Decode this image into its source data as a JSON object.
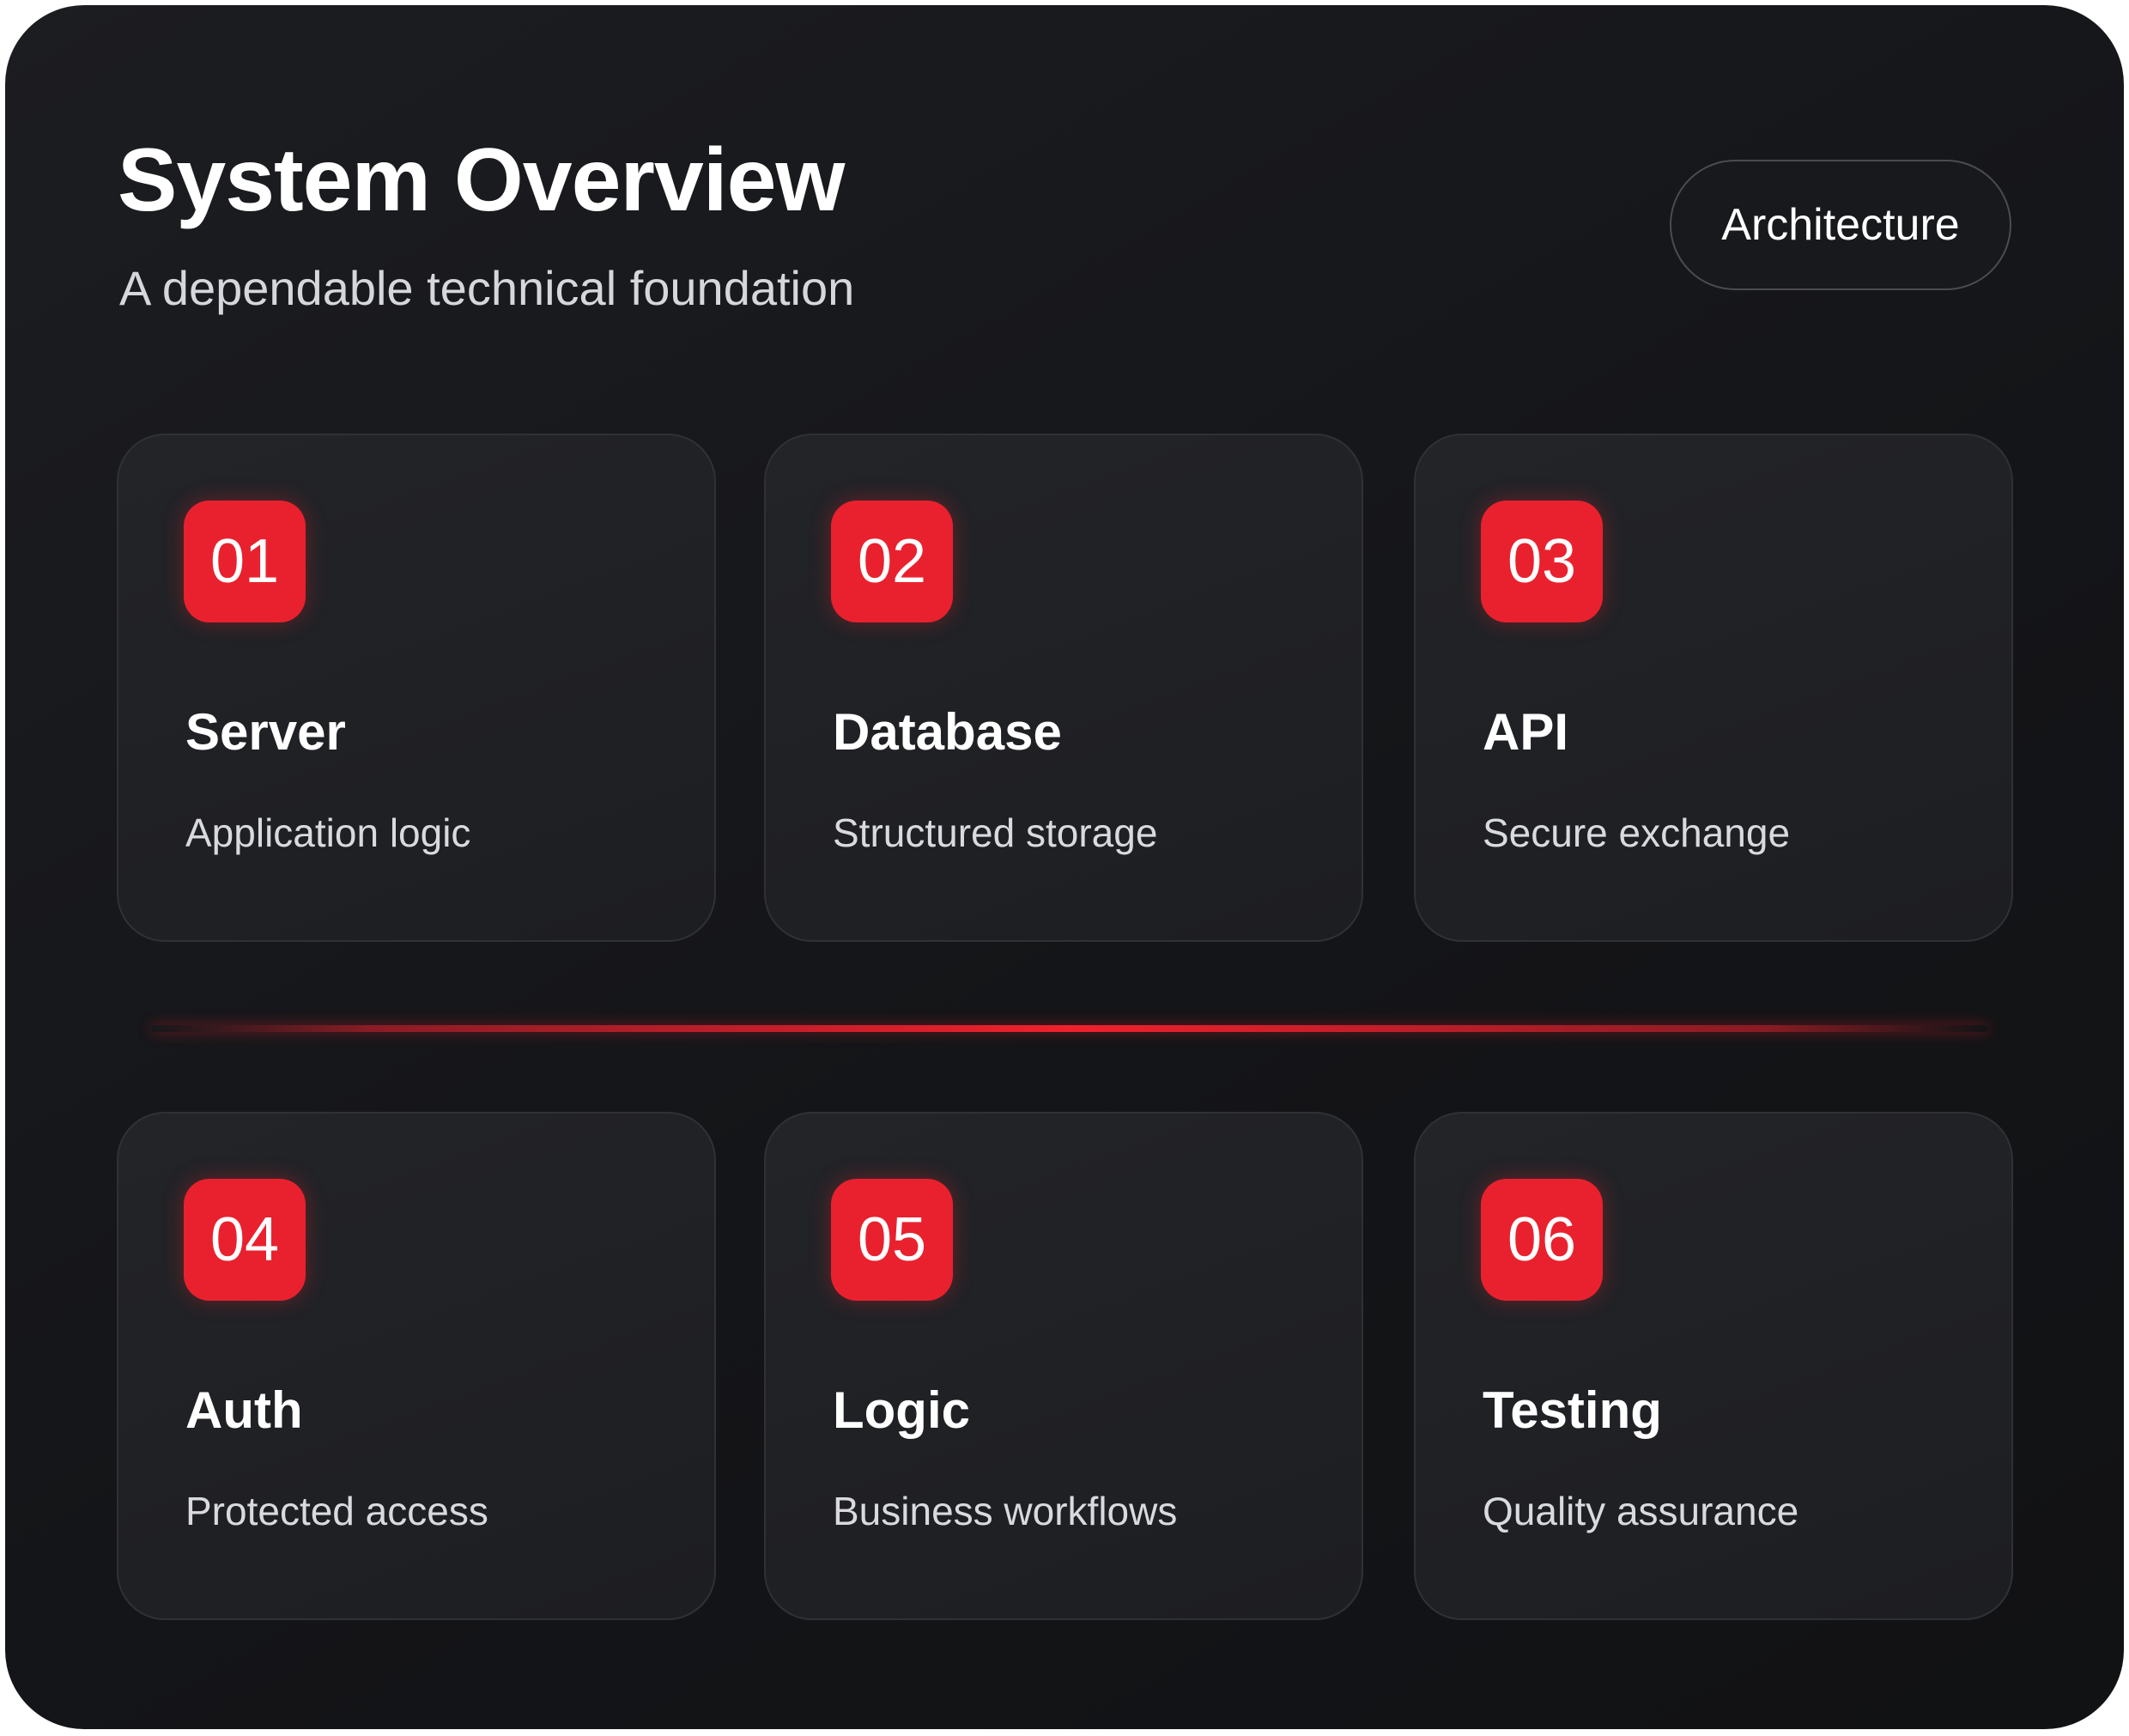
{
  "header": {
    "title": "System Overview",
    "subtitle": "A dependable technical foundation",
    "action_label": "Architecture"
  },
  "cards": [
    {
      "number": "01",
      "title": "Server",
      "description": "Application logic"
    },
    {
      "number": "02",
      "title": "Database",
      "description": "Structured storage"
    },
    {
      "number": "03",
      "title": "API",
      "description": "Secure exchange"
    },
    {
      "number": "04",
      "title": "Auth",
      "description": "Protected access"
    },
    {
      "number": "05",
      "title": "Logic",
      "description": "Business workflows"
    },
    {
      "number": "06",
      "title": "Testing",
      "description": "Quality assurance"
    }
  ],
  "colors": {
    "accent": "#e9212e",
    "background": "#141518",
    "card": "#202125",
    "text": "#ffffff"
  }
}
